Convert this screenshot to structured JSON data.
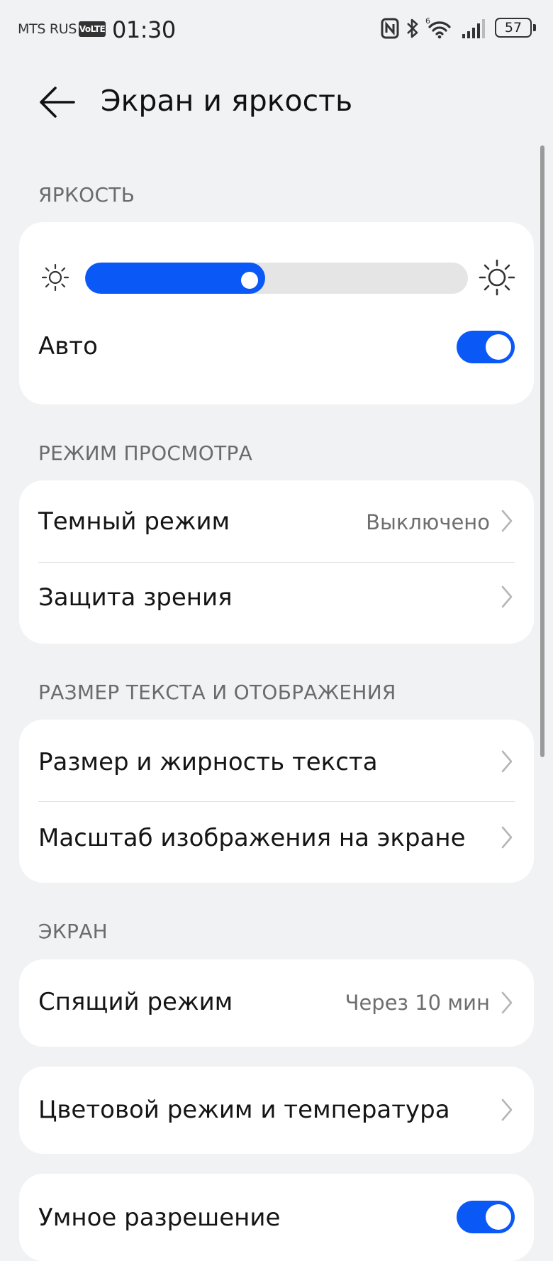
{
  "status_bar": {
    "carrier": "MTS RUS",
    "volte": "VoLTE",
    "time": "01:30",
    "battery": "57",
    "wifi_badge": "6",
    "icons": [
      "nfc-icon",
      "bluetooth-icon",
      "wifi-icon",
      "signal-icon",
      "battery-icon"
    ]
  },
  "header": {
    "title": "Экран и яркость",
    "back_icon": "arrow-left-icon"
  },
  "brightness": {
    "section": "ЯРКОСТЬ",
    "level": 0.47,
    "auto_label": "Авто",
    "auto_on": true
  },
  "view_mode": {
    "section": "РЕЖИМ ПРОСМОТРА",
    "dark_mode_label": "Темный режим",
    "dark_mode_value": "Выключено",
    "eye_comfort_label": "Защита зрения"
  },
  "text_display": {
    "section": "РАЗМЕР ТЕКСТА И ОТОБРАЖЕНИЯ",
    "text_size_label": "Размер и жирность текста",
    "display_scale_label": "Масштаб изображения на экране"
  },
  "screen": {
    "section": "ЭКРАН",
    "sleep_label": "Спящий режим",
    "sleep_value": "Через 10 мин",
    "color_mode_label": "Цветовой режим и температура",
    "smart_resolution_label": "Умное разрешение",
    "smart_resolution_on": true
  },
  "colors": {
    "accent": "#0a59f7",
    "background": "#f1f2f4",
    "card": "#ffffff"
  }
}
